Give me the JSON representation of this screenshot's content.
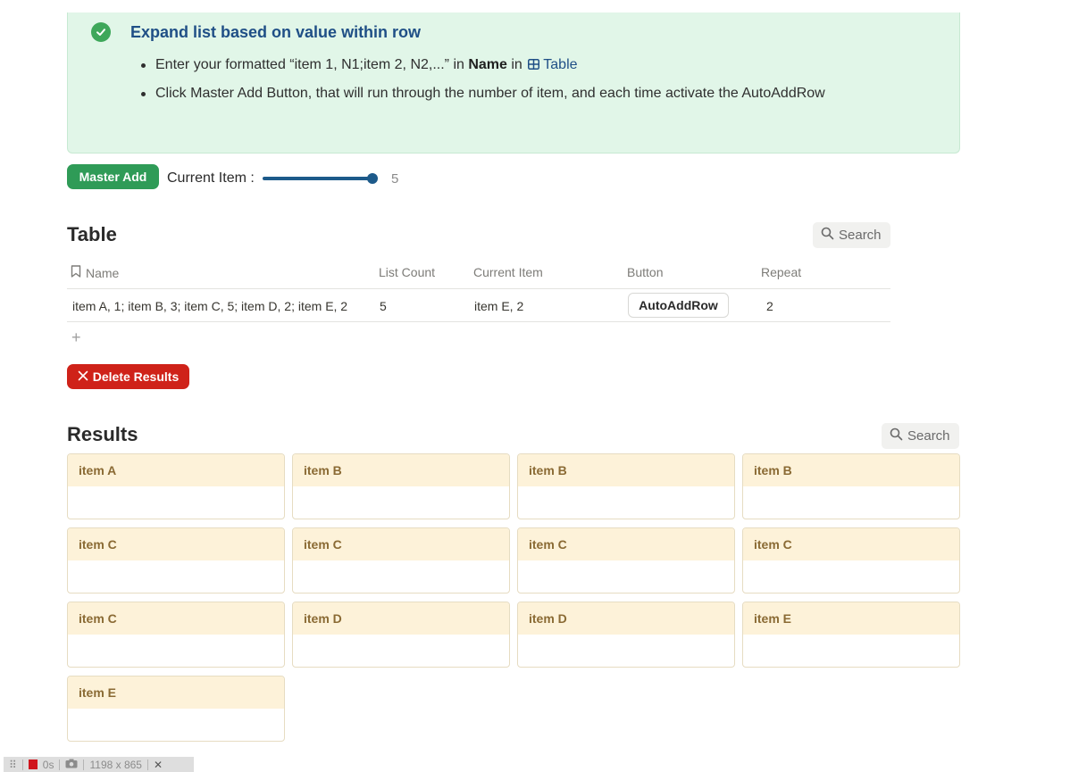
{
  "callout": {
    "title": "Expand list based on value within row",
    "bullet1_prefix": "Enter your formatted “item 1, N1;item 2, N2,...” in ",
    "bullet1_bold": "Name",
    "bullet1_mid": " in ",
    "bullet1_link": "Table",
    "bullet2": "Click Master Add Button, that will run through the number of item, and each time activate the AutoAddRow"
  },
  "controls": {
    "master_add_label": "Master Add",
    "current_item_label": "Current Item :",
    "slider_value": "5",
    "slider_fraction": 1.0
  },
  "table": {
    "title": "Table",
    "search_label": "Search",
    "columns": [
      "Name",
      "List Count",
      "Current Item",
      "Button",
      "Repeat"
    ],
    "rows": [
      {
        "name": "item A, 1; item B, 3; item C, 5; item D, 2; item E, 2",
        "list_count": "5",
        "current_item": "item E, 2",
        "button_label": "AutoAddRow",
        "repeat": "2"
      }
    ],
    "add_row_symbol": "+"
  },
  "delete_button_label": "Delete Results",
  "results": {
    "title": "Results",
    "search_label": "Search",
    "cards": [
      "item A",
      "item B",
      "item B",
      "item B",
      "item C",
      "item C",
      "item C",
      "item C",
      "item C",
      "item D",
      "item D",
      "item E",
      "item E"
    ]
  },
  "devbar": {
    "time": "0s",
    "size": "1198 x 865",
    "close": "✕"
  },
  "colors": {
    "callout_bg": "#e1f6e8",
    "master_add_bg": "#2f9b57",
    "delete_bg": "#cf2219",
    "slider": "#1d5a8a",
    "card_header_bg": "#fdf2d9"
  }
}
